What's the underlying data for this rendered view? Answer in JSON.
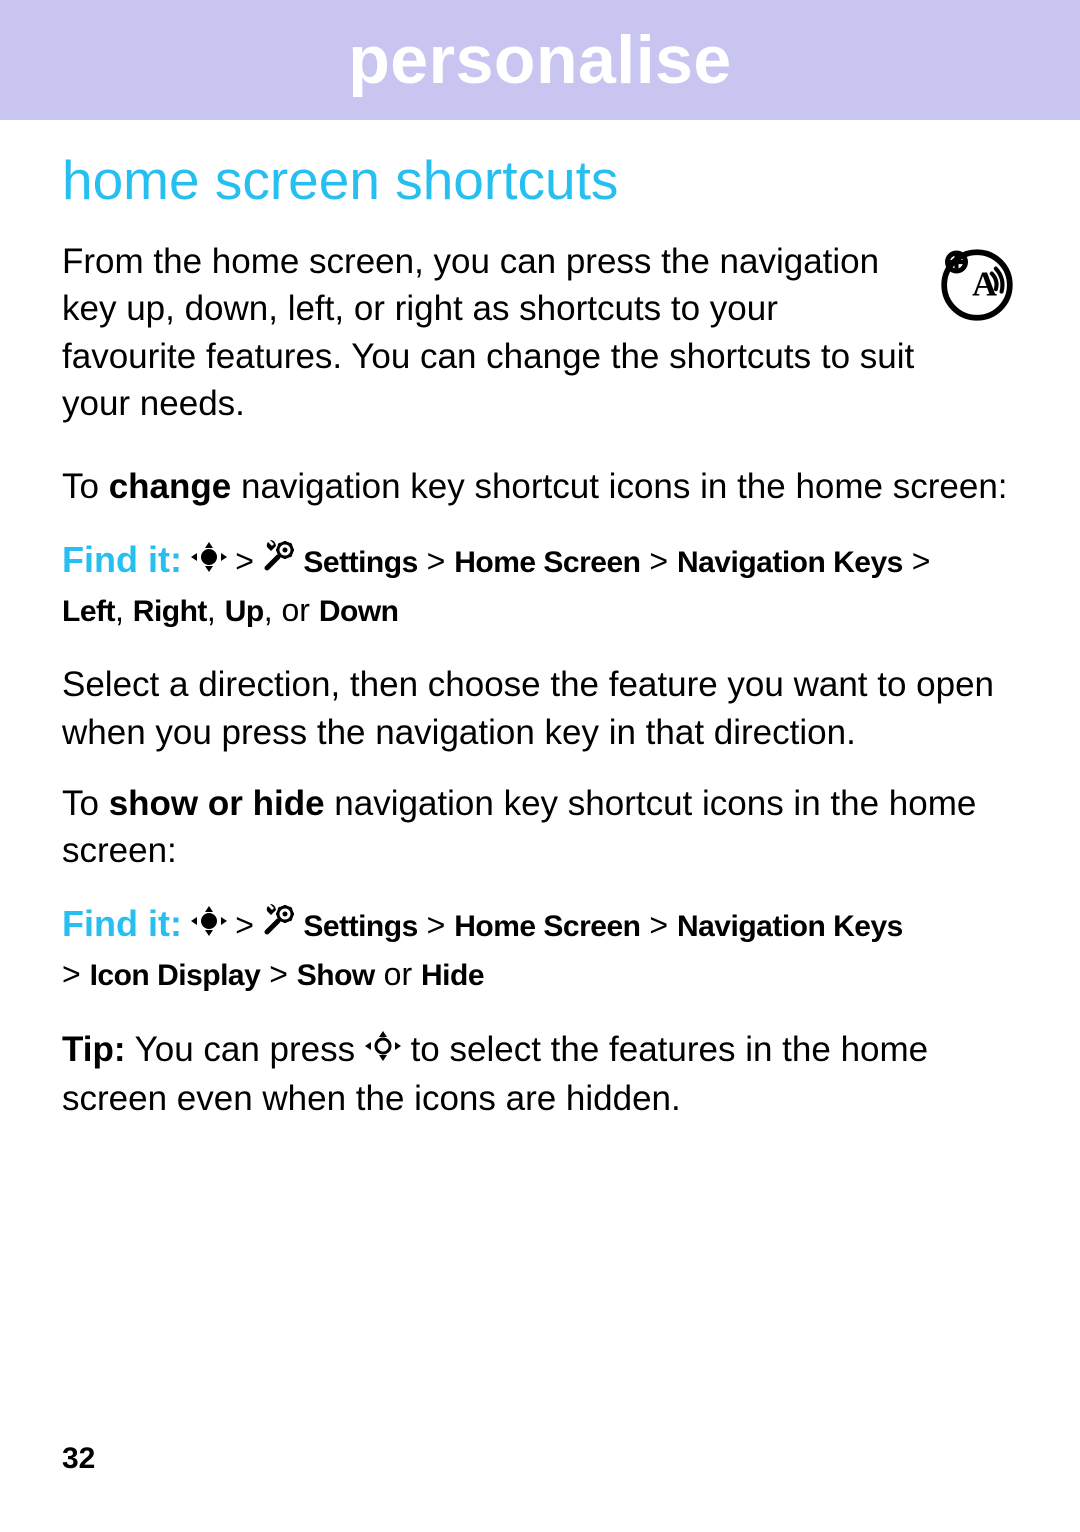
{
  "header": {
    "title": "personalise"
  },
  "section": {
    "title": "home screen shortcuts"
  },
  "intro": {
    "text": "From the home screen, you can press the navigation key up, down, left, or right as shortcuts to your favourite features. You can change the shortcuts to suit your needs."
  },
  "change": {
    "pre": "To ",
    "bold": "change",
    "post": " navigation key shortcut icons in the home screen:"
  },
  "find_it_label": "Find it:",
  "path1": {
    "sep": " > ",
    "settings": "Settings",
    "home_screen": "Home Screen",
    "nav_keys": "Navigation Keys",
    "left": "Left",
    "right": "Right",
    "up": "Up",
    "or": " or ",
    "down": "Down",
    "comma": ", "
  },
  "select_para": "Select a direction, then choose the feature you want to open when you press the navigation key in that direction.",
  "show_hide": {
    "pre": "To ",
    "bold": "show or hide",
    "post": " navigation key shortcut icons in the home screen:"
  },
  "path2": {
    "sep": " > ",
    "settings": "Settings",
    "home_screen": "Home Screen",
    "nav_keys": "Navigation Keys",
    "icon_display": "Icon Display",
    "show": "Show",
    "or": " or ",
    "hide": "Hide"
  },
  "tip": {
    "label": "Tip:",
    "pre": " You can press ",
    "post": " to select the features in the home screen even when the icons are hidden."
  },
  "page_number": "32"
}
